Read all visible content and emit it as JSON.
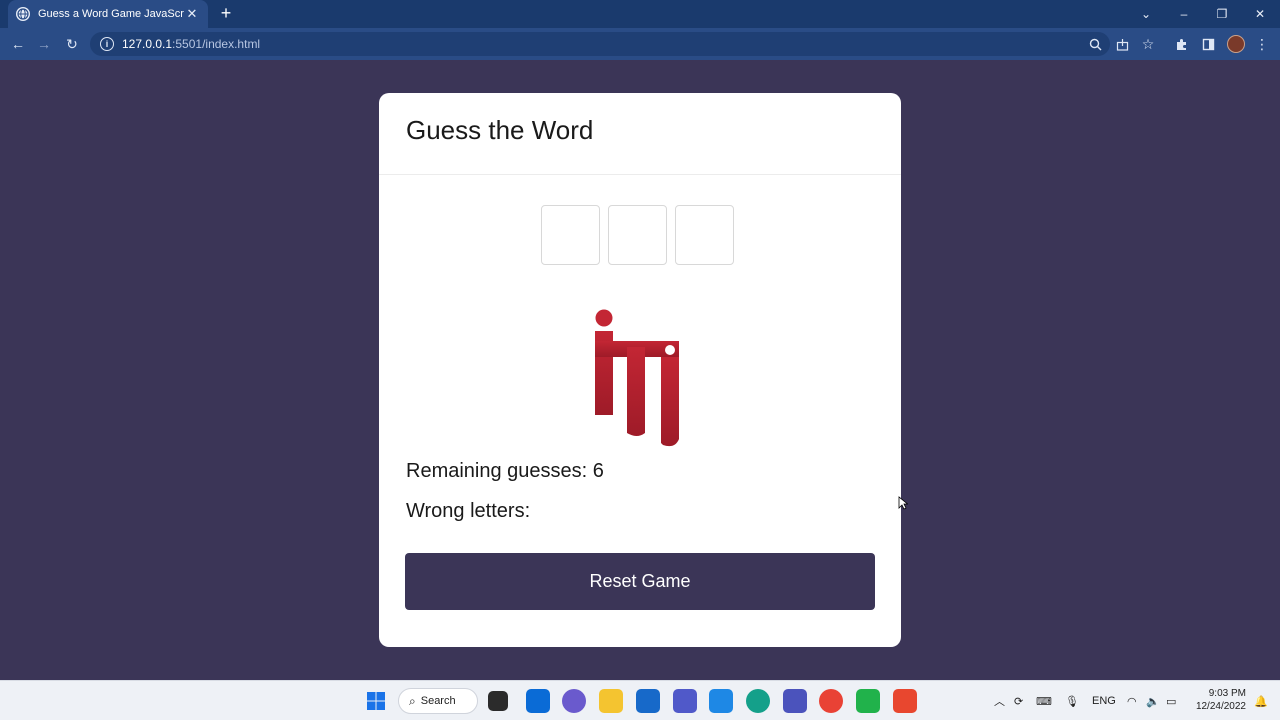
{
  "browser": {
    "tab_title": "Guess a Word Game JavaScript |",
    "tab_close": "✕",
    "new_tab": "+",
    "url_host": "127.0.0.1",
    "url_rest": ":5501/index.html",
    "window": {
      "dropdown": "⌄",
      "minimize": "–",
      "restore": "❐",
      "close": "✕"
    }
  },
  "game": {
    "title": "Guess the Word",
    "letter_slots": 3,
    "remaining_label": "Remaining guesses: 6",
    "wrong_label": "Wrong letters:",
    "reset_label": "Reset Game"
  },
  "taskbar": {
    "search_label": "Search",
    "language": "ENG",
    "time": "9:03 PM",
    "date": "12/24/2022"
  },
  "colors": {
    "page_bg": "#3b3557",
    "button_bg": "#3b3557",
    "logo_red": "#b3202e",
    "browser_dark": "#1a3a6d",
    "browser_toolbar": "#2a4c86"
  }
}
